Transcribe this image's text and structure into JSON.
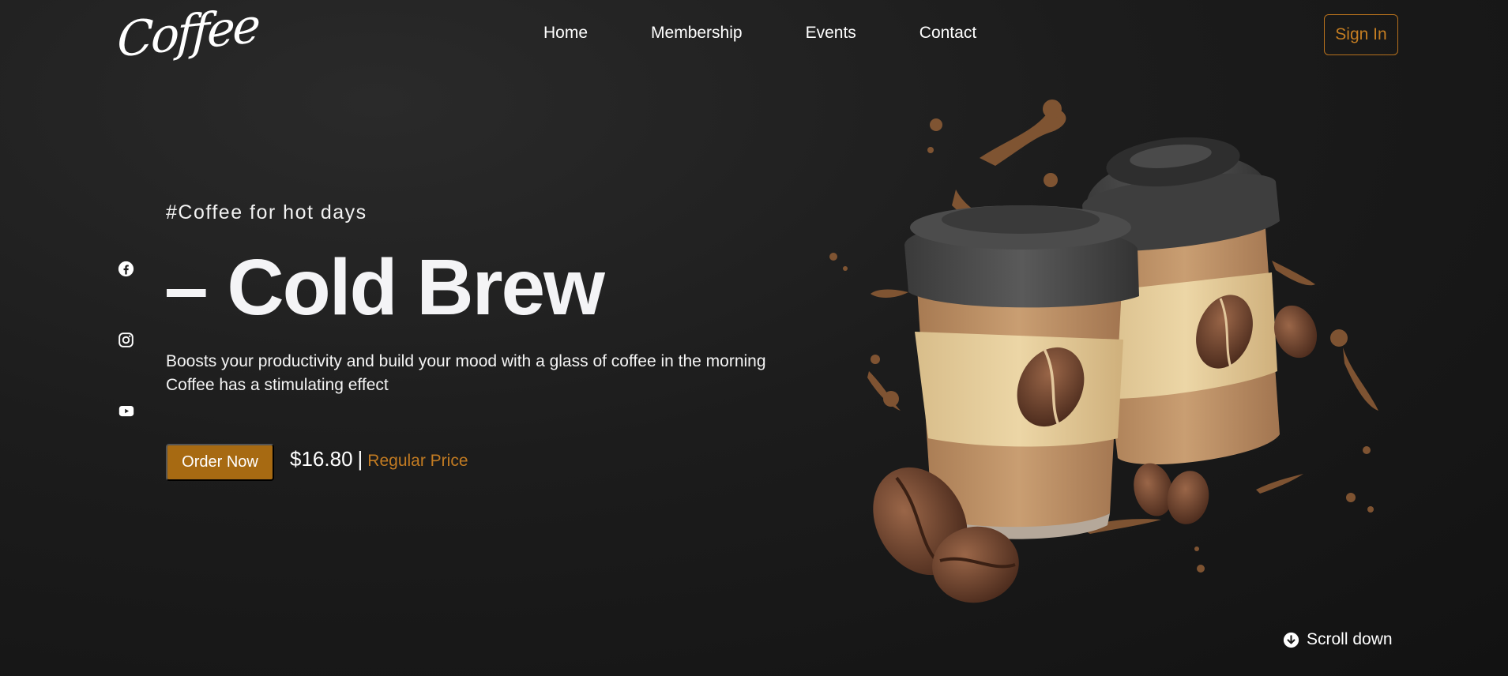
{
  "brand": {
    "logo_text": "Coffee"
  },
  "nav": {
    "items": [
      "Home",
      "Membership",
      "Events",
      "Contact"
    ],
    "signin_label": "Sign In"
  },
  "social": {
    "icons": [
      "facebook-icon",
      "instagram-icon",
      "youtube-icon"
    ]
  },
  "hero": {
    "tagline": "#Coffee for hot days",
    "headline": "– Cold Brew",
    "description": "Boosts your productivity and build your mood with a glass of coffee in the morning Coffee has a stimulating effect",
    "order_label": "Order Now",
    "price": "$16.80",
    "price_separator": "|",
    "price_note": "Regular Price",
    "image_icon": "coffee-cups-illustration"
  },
  "scroll": {
    "label": "Scroll down",
    "icon": "arrow-down-circle-icon"
  },
  "colors": {
    "background": "#1c1c1c",
    "accent": "#a76a12",
    "accent_text": "#c27b22"
  }
}
